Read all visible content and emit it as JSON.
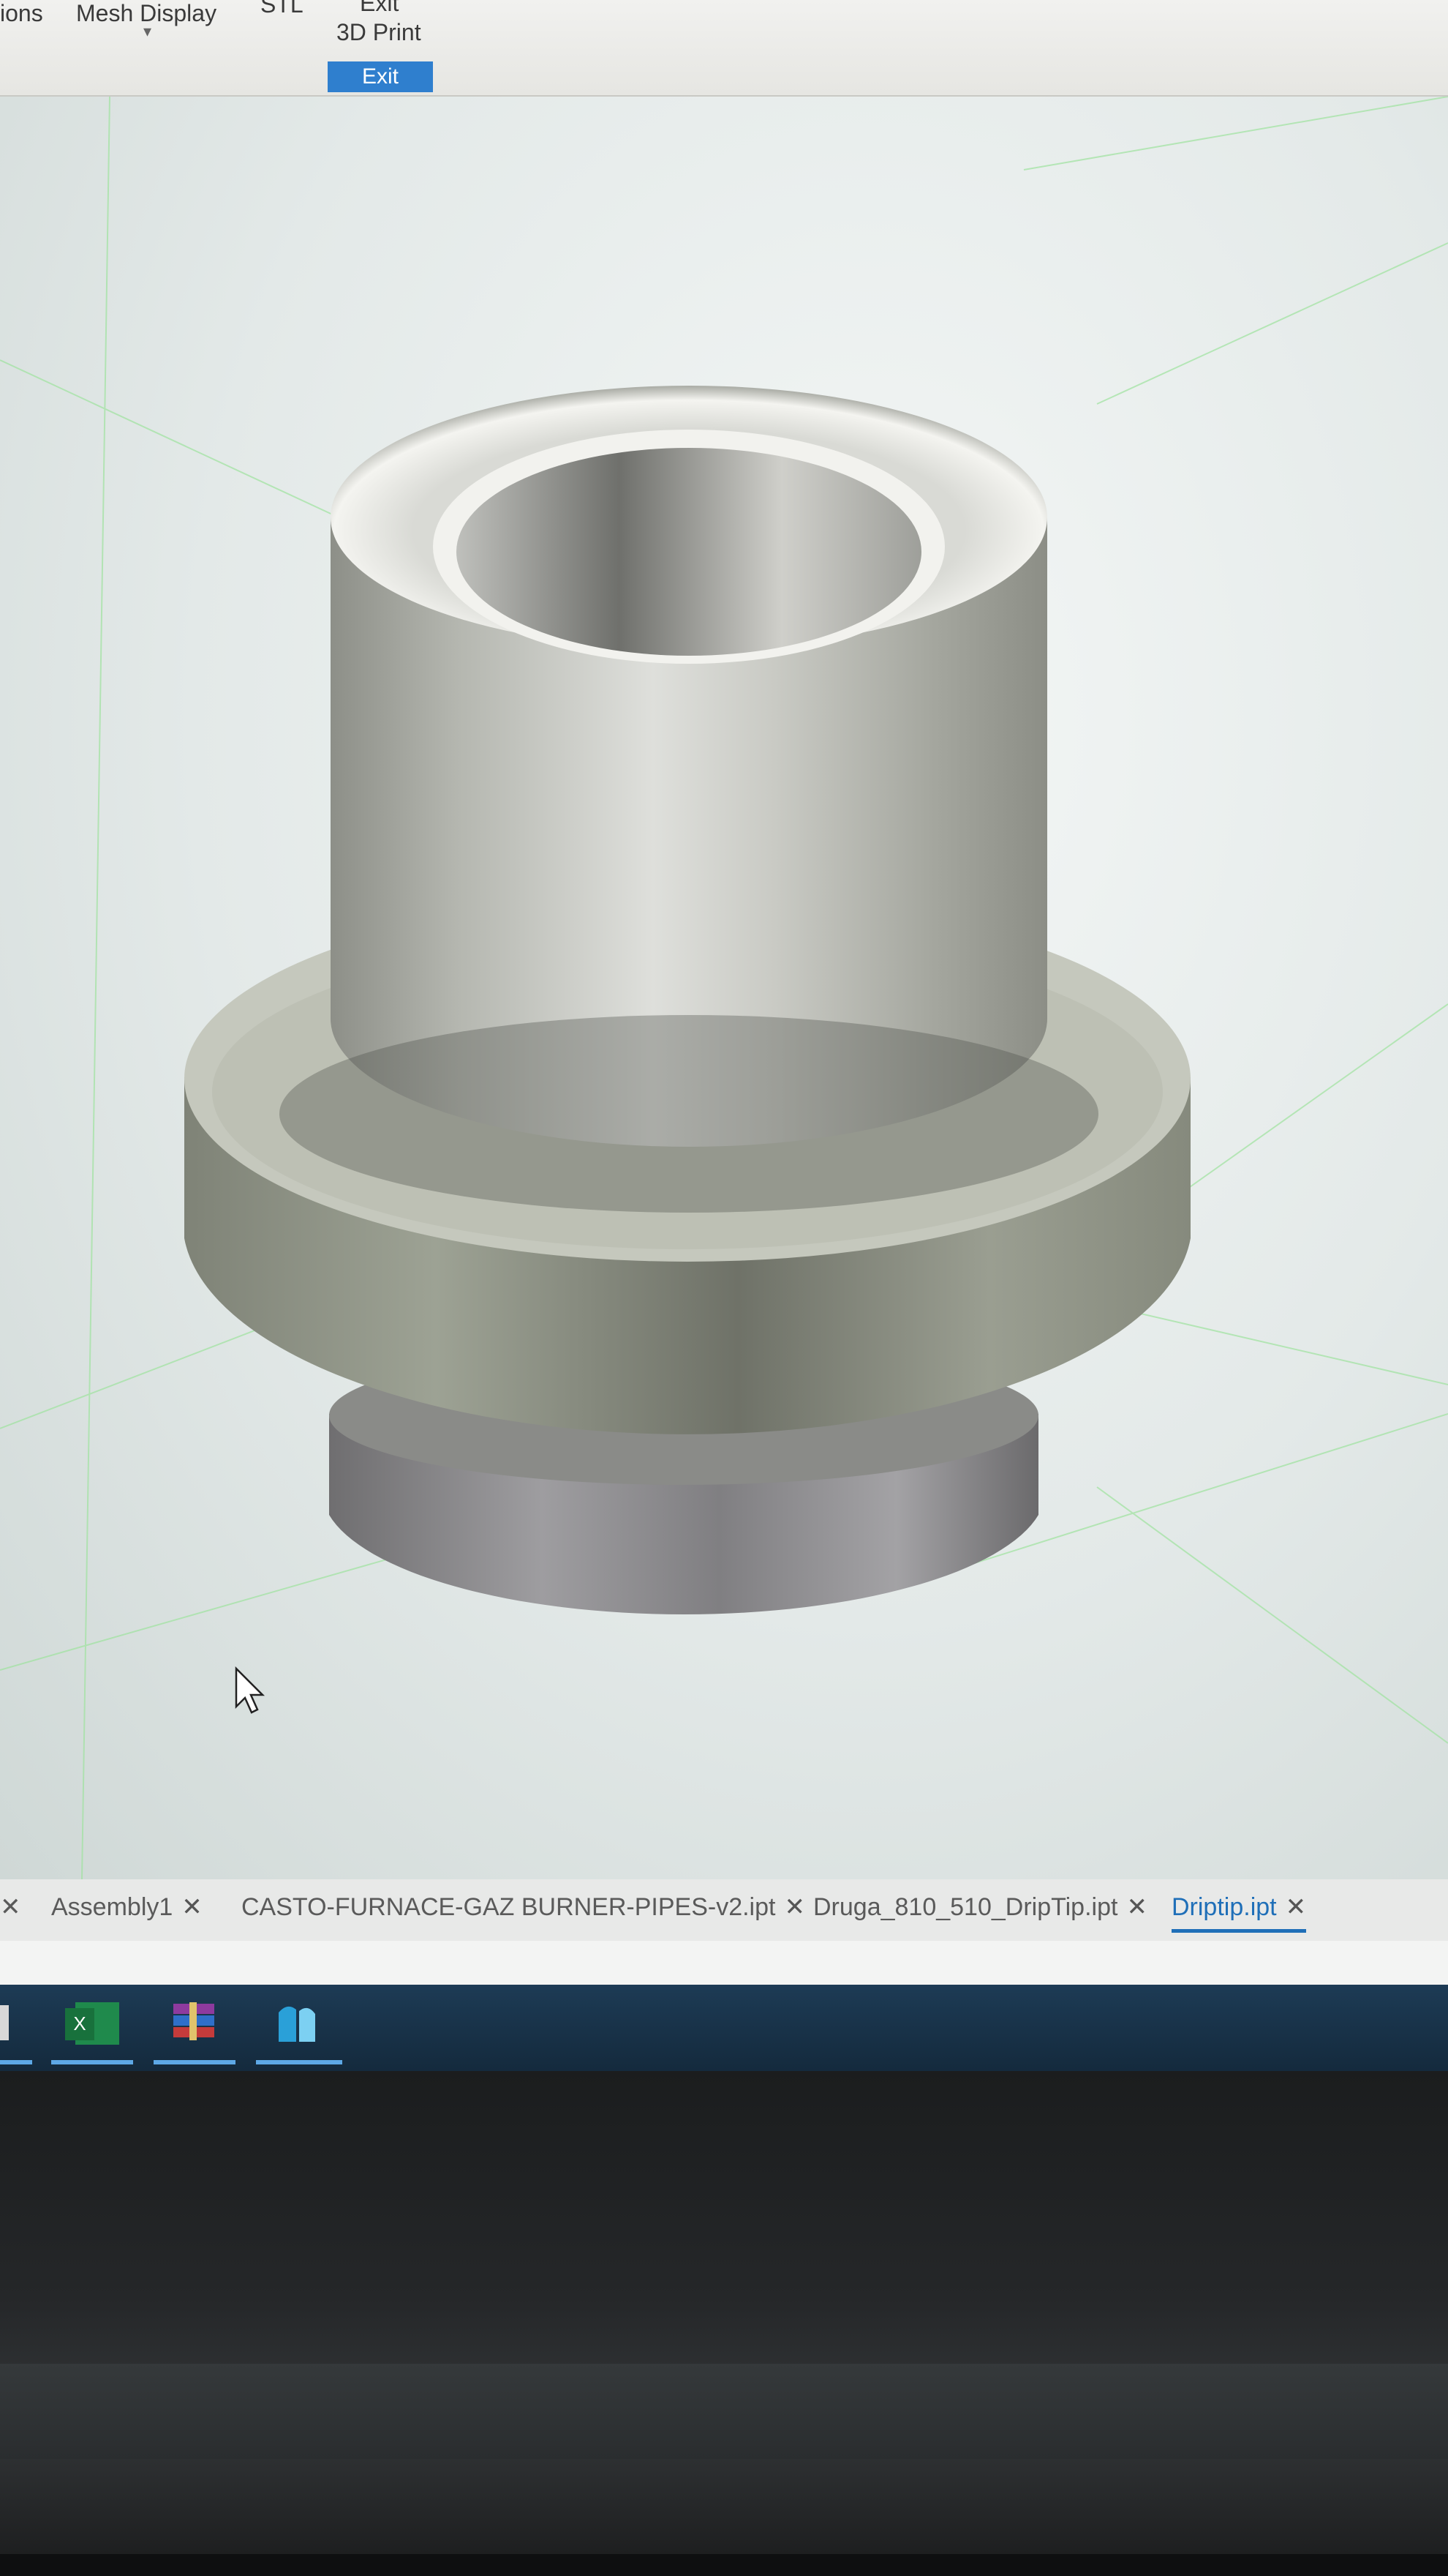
{
  "ribbon": {
    "options_label": "ions",
    "mesh_display_label": "Mesh Display",
    "stl_label": "STL",
    "exit_group_label": "Exit",
    "print_3d_label": "3D Print",
    "exit_button_label": "Exit"
  },
  "document_tabs": [
    {
      "label": "Assembly1",
      "active": false
    },
    {
      "label": "CASTO-FURNACE-GAZ BURNER-PIPES-v2.ipt",
      "active": false
    },
    {
      "label": "Druga_810_510_DripTip.ipt",
      "active": false
    },
    {
      "label": "Driptip.ipt",
      "active": true
    }
  ],
  "close_glyph": "✕",
  "taskbar": {
    "icons": [
      "app-icon",
      "excel-icon",
      "winrar-icon",
      "inventor-icon"
    ],
    "excel_letter": "X"
  },
  "colors": {
    "accent": "#1f6fb8",
    "exit_button": "#2f7fce",
    "taskbar": "#1d3b55",
    "grid": "#9fe39f"
  }
}
